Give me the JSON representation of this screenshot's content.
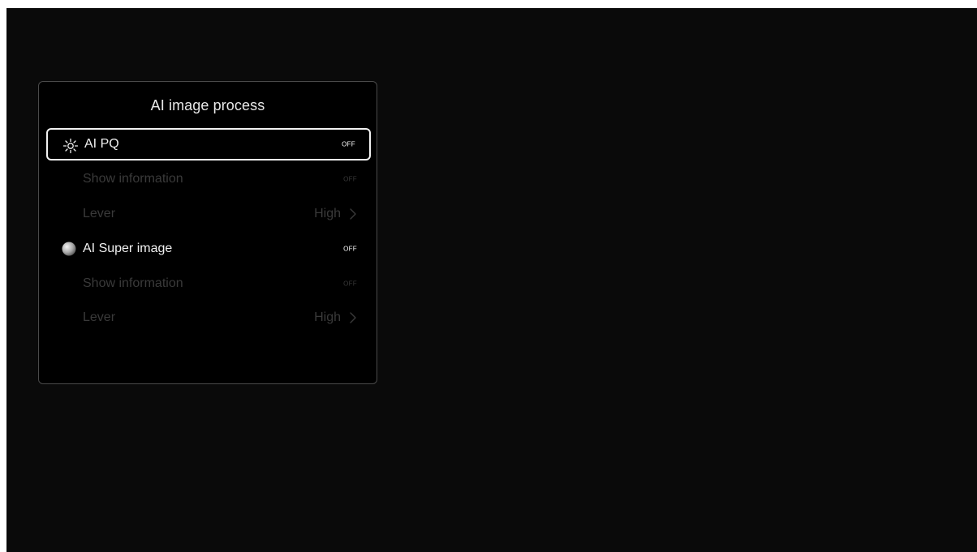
{
  "panel": {
    "title": "AI image process"
  },
  "rows": [
    {
      "label": "AI PQ",
      "status": "OFF",
      "icon": "sun-icon",
      "state": "focused"
    },
    {
      "label": "Show information",
      "status": "OFF",
      "state": "disabled"
    },
    {
      "label": "Lever",
      "value": "High",
      "icon": "chevron-right-icon",
      "state": "disabled"
    },
    {
      "label": "AI Super image",
      "status": "OFF",
      "icon": "circle-icon",
      "state": "enabled"
    },
    {
      "label": "Show information",
      "status": "OFF",
      "state": "disabled"
    },
    {
      "label": "Lever",
      "value": "High",
      "icon": "chevron-right-icon",
      "state": "disabled"
    }
  ],
  "colors": {
    "background": "#0a0a0a",
    "panel": "#000000",
    "focus_border": "#f2f2f2",
    "text": "#f0f0f0",
    "disabled_text": "#3a3a3a"
  }
}
